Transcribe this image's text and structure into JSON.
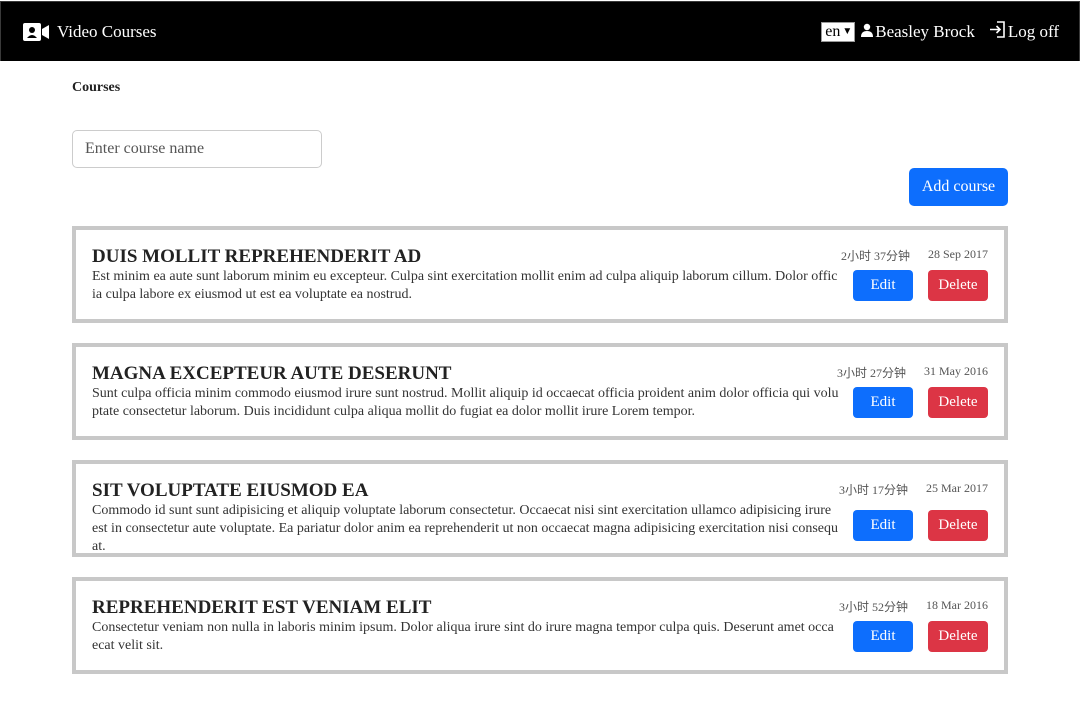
{
  "app": {
    "title": "Video Courses"
  },
  "header": {
    "lang": "en",
    "user_name": "Beasley Brock",
    "logoff": "Log off"
  },
  "page": {
    "section_title": "Courses",
    "search_placeholder": "Enter course name",
    "add_button": "Add course"
  },
  "courses": [
    {
      "title": "DUIS MOLLIT REPREHENDERIT AD",
      "description": "Est minim ea aute sunt laborum minim eu excepteur. Culpa sint exercitation mollit enim ad culpa aliquip laborum cillum. Dolor officia culpa labore ex eiusmod ut est ea voluptate ea nostrud.",
      "duration": "2小时 37分钟",
      "date": "28 Sep 2017",
      "edit": "Edit",
      "delete": "Delete"
    },
    {
      "title": "MAGNA EXCEPTEUR AUTE DESERUNT",
      "description": "Sunt culpa officia minim commodo eiusmod irure sunt nostrud. Mollit aliquip id occaecat officia proident anim dolor officia qui voluptate consectetur laborum. Duis incididunt culpa aliqua mollit do fugiat ea dolor mollit irure Lorem tempor.",
      "duration": "3小时 27分钟",
      "date": "31 May 2016",
      "edit": "Edit",
      "delete": "Delete"
    },
    {
      "title": "SIT VOLUPTATE EIUSMOD EA",
      "description": "Commodo id sunt sunt adipisicing et aliquip voluptate laborum consectetur. Occaecat nisi sint exercitation ullamco adipisicing irure est in consectetur aute voluptate. Ea pariatur dolor anim ea reprehenderit ut non occaecat magna adipisicing exercitation nisi consequat.",
      "duration": "3小时 17分钟",
      "date": "25 Mar 2017",
      "edit": "Edit",
      "delete": "Delete"
    },
    {
      "title": "REPREHENDERIT EST VENIAM ELIT",
      "description": "Consectetur veniam non nulla in laboris minim ipsum. Dolor aliqua irure sint do irure magna tempor culpa quis. Deserunt amet occaecat velit sit.",
      "duration": "3小时 52分钟",
      "date": "18 Mar 2016",
      "edit": "Edit",
      "delete": "Delete"
    }
  ]
}
